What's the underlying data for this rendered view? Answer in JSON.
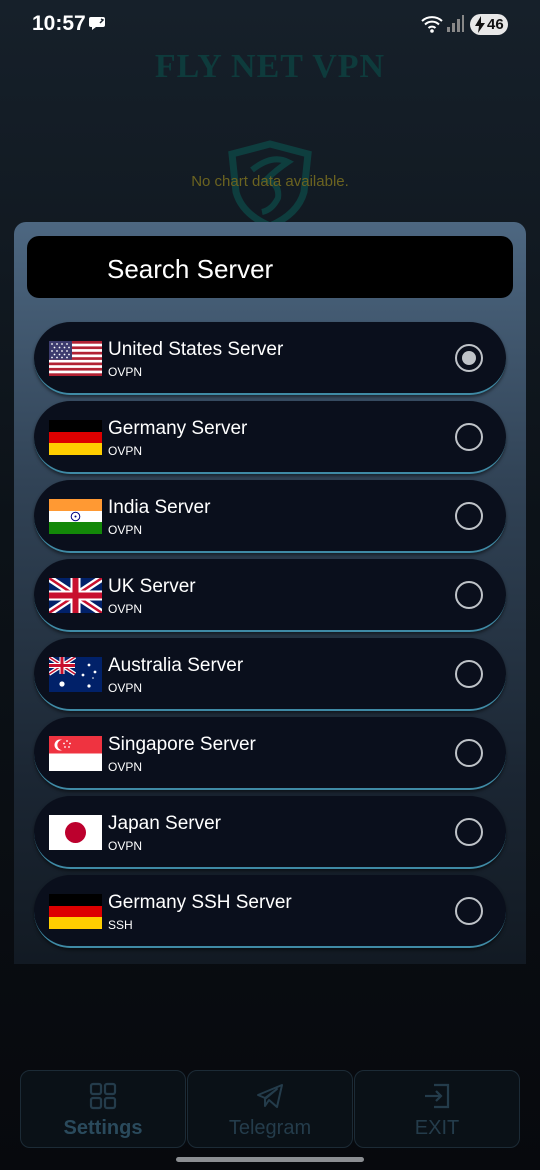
{
  "status": {
    "time": "10:57",
    "battery": "46"
  },
  "app": {
    "title": "FLY NET VPN",
    "chart_message": "No chart data available."
  },
  "search": {
    "placeholder": "Search Server"
  },
  "servers": [
    {
      "name": "United States Server",
      "type": "OVPN",
      "flag": "us-flag-icon",
      "selected": true
    },
    {
      "name": "Germany Server",
      "type": "OVPN",
      "flag": "germany-flag-icon",
      "selected": false
    },
    {
      "name": "India Server",
      "type": "OVPN",
      "flag": "india-flag-icon",
      "selected": false
    },
    {
      "name": "UK Server",
      "type": "OVPN",
      "flag": "uk-flag-icon",
      "selected": false
    },
    {
      "name": "Australia Server",
      "type": "OVPN",
      "flag": "australia-flag-icon",
      "selected": false
    },
    {
      "name": "Singapore Server",
      "type": "OVPN",
      "flag": "singapore-flag-icon",
      "selected": false
    },
    {
      "name": "Japan Server",
      "type": "OVPN",
      "flag": "japan-flag-icon",
      "selected": false
    },
    {
      "name": "Germany SSH Server",
      "type": "SSH",
      "flag": "germany-flag-icon",
      "selected": false
    }
  ],
  "nav": {
    "settings": "Settings",
    "telegram": "Telegram",
    "exit": "EXIT"
  },
  "colors": {
    "accent": "#3f8aa5",
    "title": "#0e3b3c",
    "item_bg": "#0a0f1c"
  }
}
